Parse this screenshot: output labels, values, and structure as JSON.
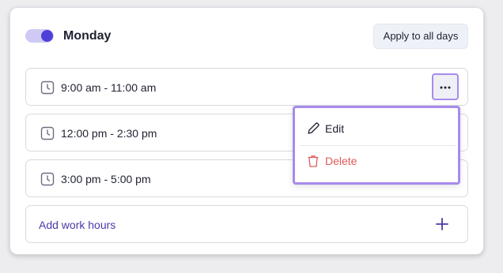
{
  "day": {
    "name": "Monday",
    "enabled": true,
    "apply_label": "Apply to all days"
  },
  "slots": [
    {
      "time": "9:00 am - 11:00 am"
    },
    {
      "time": "12:00 pm - 2:30 pm"
    },
    {
      "time": "3:00 pm - 5:00 pm"
    }
  ],
  "add": {
    "label": "Add work hours",
    "icon": "plus-icon"
  },
  "more_menu": {
    "trigger_icon": "more-horizontal-icon",
    "trigger_glyph": "···",
    "items": [
      {
        "label": "Edit",
        "icon": "pencil-icon"
      },
      {
        "label": "Delete",
        "icon": "trash-icon"
      }
    ]
  },
  "colors": {
    "accent": "#4e3fd8",
    "toggle_track": "#cfcaf4",
    "highlight": "#a78bec",
    "danger": "#e05a5a",
    "link": "#4a3aa8"
  }
}
